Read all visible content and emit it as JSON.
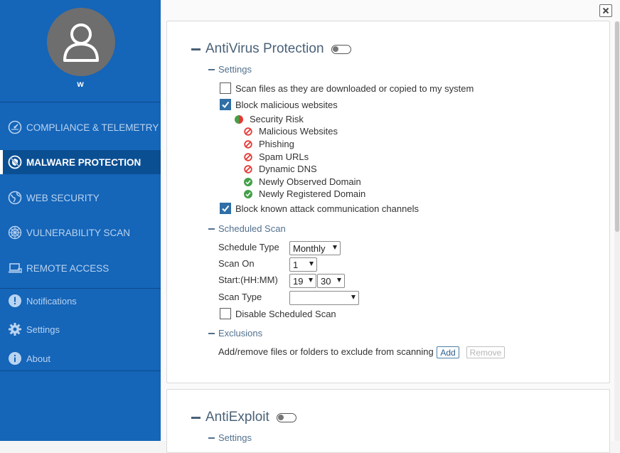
{
  "sidebar": {
    "username": "w",
    "nav": [
      {
        "label": "COMPLIANCE & TELEMETRY",
        "icon": "gauge-icon"
      },
      {
        "label": "MALWARE PROTECTION",
        "icon": "shield-ban-icon",
        "active": true
      },
      {
        "label": "WEB SECURITY",
        "icon": "globe-icon"
      },
      {
        "label": "VULNERABILITY SCAN",
        "icon": "radar-icon"
      },
      {
        "label": "REMOTE ACCESS",
        "icon": "laptop-icon"
      }
    ],
    "secondary": [
      {
        "label": "Notifications",
        "icon": "exclamation-icon"
      },
      {
        "label": "Settings",
        "icon": "gear-icon"
      },
      {
        "label": "About",
        "icon": "info-icon"
      }
    ]
  },
  "antivirus": {
    "title": "AntiVirus Protection",
    "enabled": false,
    "settings": {
      "title": "Settings",
      "scan_downloads": {
        "label": "Scan files as they are downloaded or copied to my system",
        "checked": false
      },
      "block_malicious": {
        "label": "Block malicious websites",
        "checked": true
      },
      "categories": [
        {
          "label": "Security Risk",
          "status": "partial"
        },
        {
          "label": "Malicious Websites",
          "status": "blocked"
        },
        {
          "label": "Phishing",
          "status": "blocked"
        },
        {
          "label": "Spam URLs",
          "status": "blocked"
        },
        {
          "label": "Dynamic DNS",
          "status": "blocked"
        },
        {
          "label": "Newly Observed Domain",
          "status": "allowed"
        },
        {
          "label": "Newly Registered Domain",
          "status": "allowed"
        }
      ],
      "block_attack": {
        "label": "Block known attack communication channels",
        "checked": true
      }
    },
    "scheduled": {
      "title": "Scheduled Scan",
      "schedule_type_label": "Schedule Type",
      "schedule_type_value": "Monthly",
      "scan_on_label": "Scan On",
      "scan_on_value": "1",
      "start_label": "Start:(HH:MM)",
      "start_hour": "19",
      "start_minute": "30",
      "scan_type_label": "Scan Type",
      "scan_type_value": "",
      "disable": {
        "label": "Disable Scheduled Scan",
        "checked": false
      }
    },
    "exclusions": {
      "title": "Exclusions",
      "text": "Add/remove files or folders to exclude from scanning",
      "add_label": "Add",
      "remove_label": "Remove"
    }
  },
  "antiexploit": {
    "title": "AntiExploit",
    "enabled": false,
    "settings_title": "Settings"
  },
  "colors": {
    "sidebar_bg": "#1565b8",
    "sidebar_active": "#0b4f93",
    "checkbox_checked": "#2f6fa6",
    "blocked_red": "#e53935",
    "allowed_green": "#43a047"
  }
}
